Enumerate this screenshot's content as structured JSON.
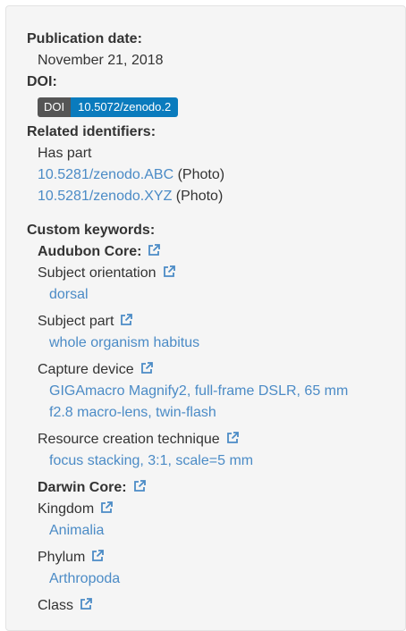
{
  "publication_date": {
    "label": "Publication date:",
    "value": "November 21, 2018"
  },
  "doi": {
    "label": "DOI:",
    "badge_prefix": "DOI",
    "badge_value": "10.5072/zenodo.2"
  },
  "related_identifiers": {
    "label": "Related identifiers:",
    "relation": "Has part",
    "items": [
      {
        "id": "10.5281/zenodo.ABC",
        "type": "(Photo)"
      },
      {
        "id": "10.5281/zenodo.XYZ",
        "type": "(Photo)"
      }
    ]
  },
  "custom_keywords": {
    "label": "Custom keywords:",
    "audubon": {
      "title": "Audubon Core:",
      "fields": [
        {
          "name": "Subject orientation",
          "values": [
            "dorsal"
          ]
        },
        {
          "name": "Subject part",
          "values": [
            "whole organism habitus"
          ]
        },
        {
          "name": "Capture device",
          "values": [
            "GIGAmacro Magnify2, full-frame DSLR, 65 mm",
            "f2.8 macro-lens, twin-flash"
          ]
        },
        {
          "name": "Resource creation technique",
          "values": [
            "focus stacking, 3:1, scale=5 mm"
          ]
        }
      ]
    },
    "darwin": {
      "title": "Darwin Core:",
      "fields": [
        {
          "name": "Kingdom",
          "values": [
            "Animalia"
          ]
        },
        {
          "name": "Phylum",
          "values": [
            "Arthropoda"
          ]
        },
        {
          "name": "Class",
          "values": []
        }
      ]
    }
  },
  "colors": {
    "link": "#4b8bc6",
    "doi_badge_prefix": "#555555",
    "doi_badge_value": "#0a7bbd"
  },
  "icons": {
    "external_link": "external-link-icon"
  }
}
